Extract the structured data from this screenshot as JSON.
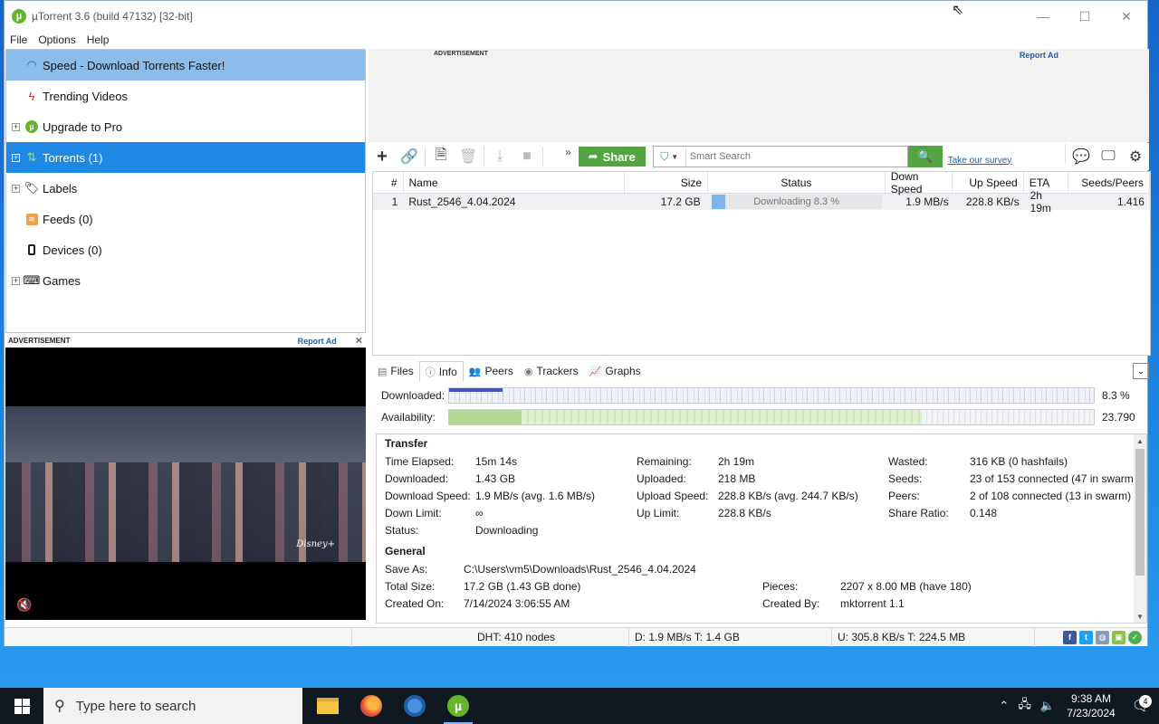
{
  "window": {
    "title": "µTorrent 3.6  (build 47132) [32-bit]",
    "controls": {
      "minimize": "—",
      "maximize": "☐",
      "close": "✕"
    }
  },
  "menu": [
    "File",
    "Options",
    "Help"
  ],
  "sidebar": {
    "items": [
      {
        "label": "Speed - Download Torrents Faster!",
        "icon": "speed-icon"
      },
      {
        "label": "Trending Videos",
        "icon": "bolt-icon"
      },
      {
        "label": "Upgrade to Pro",
        "icon": "utorrent-icon"
      },
      {
        "label": "Torrents (1)",
        "icon": "torrents-icon"
      },
      {
        "label": "Labels",
        "icon": "tag-icon"
      },
      {
        "label": "Feeds (0)",
        "icon": "rss-icon"
      },
      {
        "label": "Devices (0)",
        "icon": "device-icon"
      },
      {
        "label": "Games",
        "icon": "gamepad-icon"
      }
    ]
  },
  "ads": {
    "left_label": "ADVERTISEMENT",
    "left_report": "Report Ad",
    "left_close": "✕",
    "top_label": "ADVERTISEMENT",
    "top_report": "Report Ad",
    "video_brand": "Disney+"
  },
  "toolbar": {
    "share_label": "Share",
    "search_placeholder": "Smart Search",
    "survey_link": "Take our survey",
    "overflow": "»"
  },
  "torrent_list": {
    "columns": [
      "#",
      "Name",
      "Size",
      "Status",
      "Down Speed",
      "Up Speed",
      "ETA",
      "Seeds/Peers"
    ],
    "rows": [
      {
        "num": "1",
        "name": "Rust_2546_4.04.2024",
        "size": "17.2 GB",
        "status": "Downloading 8.3 %",
        "progress": 0.083,
        "down_speed": "1.9 MB/s",
        "up_speed": "228.8 KB/s",
        "eta": "2h 19m",
        "seeds_peers": "1.416"
      }
    ]
  },
  "detail_tabs": [
    "Files",
    "Info",
    "Peers",
    "Trackers",
    "Graphs"
  ],
  "progress": {
    "downloaded_label": "Downloaded:",
    "downloaded_value": "8.3 %",
    "downloaded_fraction": 0.083,
    "availability_label": "Availability:",
    "availability_value": "23.790"
  },
  "transfer": {
    "title": "Transfer",
    "rows": [
      [
        "Time Elapsed:",
        "15m 14s",
        "Remaining:",
        "2h 19m",
        "Wasted:",
        "316 KB (0 hashfails)"
      ],
      [
        "Downloaded:",
        "1.43 GB",
        "Uploaded:",
        "218 MB",
        "Seeds:",
        "23 of 153 connected (47 in swarm)"
      ],
      [
        "Download Speed:",
        "1.9 MB/s (avg. 1.6 MB/s)",
        "Upload Speed:",
        "228.8 KB/s (avg. 244.7 KB/s)",
        "Peers:",
        "2 of 108 connected (13 in swarm)"
      ],
      [
        "Down Limit:",
        "∞",
        "Up Limit:",
        "228.8 KB/s",
        "Share Ratio:",
        "0.148"
      ],
      [
        "Status:",
        "Downloading",
        "",
        "",
        "",
        ""
      ]
    ]
  },
  "general": {
    "title": "General",
    "rows": [
      [
        "Save As:",
        "C:\\Users\\vm5\\Downloads\\Rust_2546_4.04.2024",
        "",
        ""
      ],
      [
        "Total Size:",
        "17.2 GB (1.43 GB done)",
        "Pieces:",
        "2207 x 8.00 MB (have 180)"
      ],
      [
        "Created On:",
        "7/14/2024 3:06:55 AM",
        "Created By:",
        "mktorrent 1.1"
      ]
    ]
  },
  "statusbar": {
    "dht": "DHT: 410 nodes",
    "down": "D: 1.9 MB/s T: 1.4 GB",
    "up": "U: 305.8 KB/s T: 224.5 MB"
  },
  "taskbar": {
    "search_placeholder": "Type here to search",
    "time": "9:38 AM",
    "date": "7/23/2024",
    "notifications": "4"
  }
}
